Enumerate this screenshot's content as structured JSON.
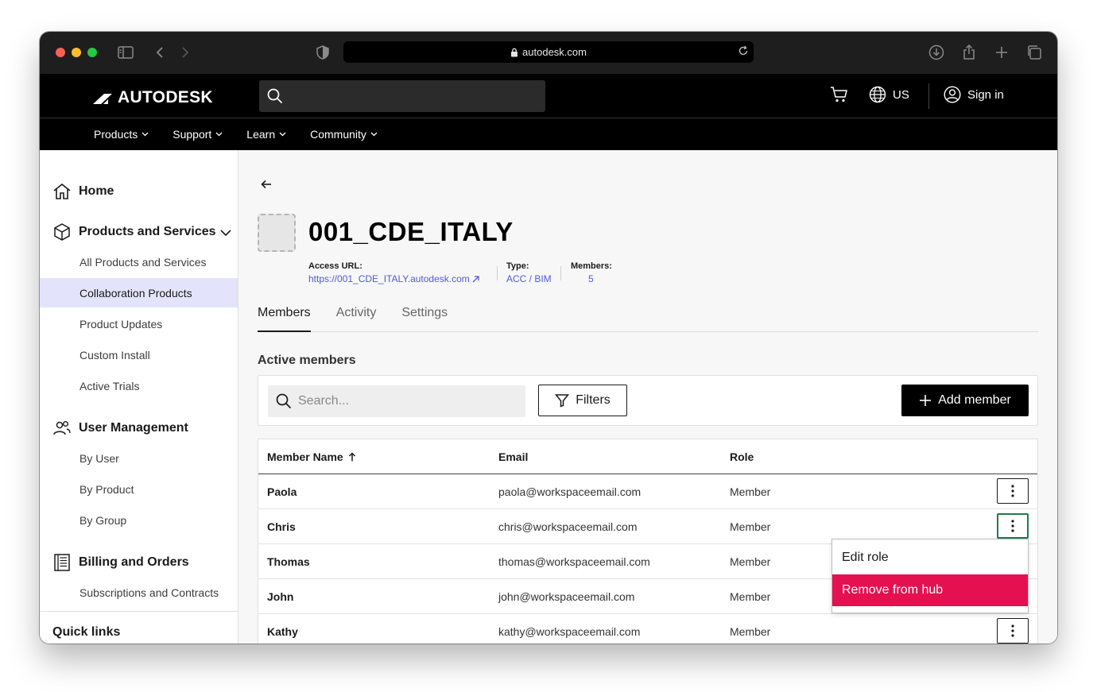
{
  "browser": {
    "url": "autodesk.com"
  },
  "header": {
    "brand": "AUTODESK",
    "region": "US",
    "sign_in": "Sign in",
    "nav": [
      "Products",
      "Support",
      "Learn",
      "Community"
    ]
  },
  "sidebar": {
    "home": "Home",
    "products_services": "Products and Services",
    "ps_items": [
      "All Products and Services",
      "Collaboration Products",
      "Product Updates",
      "Custom Install",
      "Active Trials"
    ],
    "user_management": "User Management",
    "um_items": [
      "By User",
      "By Product",
      "By Group"
    ],
    "billing": "Billing and Orders",
    "billing_items": [
      "Subscriptions and Contracts"
    ],
    "quick_links": "Quick links"
  },
  "hub": {
    "title": "001_CDE_ITALY",
    "access_url_label": "Access URL:",
    "access_url": "https://001_CDE_ITALY.autodesk.com",
    "type_label": "Type:",
    "type": "ACC / BIM",
    "members_label": "Members:",
    "members": "5"
  },
  "tabs": [
    "Members",
    "Activity",
    "Settings"
  ],
  "members_section": {
    "title": "Active members",
    "search_placeholder": "Search...",
    "filters": "Filters",
    "add_member": "Add member"
  },
  "table": {
    "columns": [
      "Member Name",
      "Email",
      "Role"
    ],
    "rows": [
      {
        "name": "Paola",
        "email": "paola@workspaceemail.com",
        "role": "Member"
      },
      {
        "name": "Chris",
        "email": "chris@workspaceemail.com",
        "role": "Member"
      },
      {
        "name": "Thomas",
        "email": "thomas@workspaceemail.com",
        "role": "Member"
      },
      {
        "name": "John",
        "email": "john@workspaceemail.com",
        "role": "Member"
      },
      {
        "name": "Kathy",
        "email": "kathy@workspaceemail.com",
        "role": "Member"
      }
    ]
  },
  "row_menu": {
    "edit_role": "Edit role",
    "remove": "Remove from hub"
  },
  "colors": {
    "accent_link": "#4f5bd5",
    "active_nav_bg": "#e3e4fb",
    "danger": "#e51050"
  }
}
